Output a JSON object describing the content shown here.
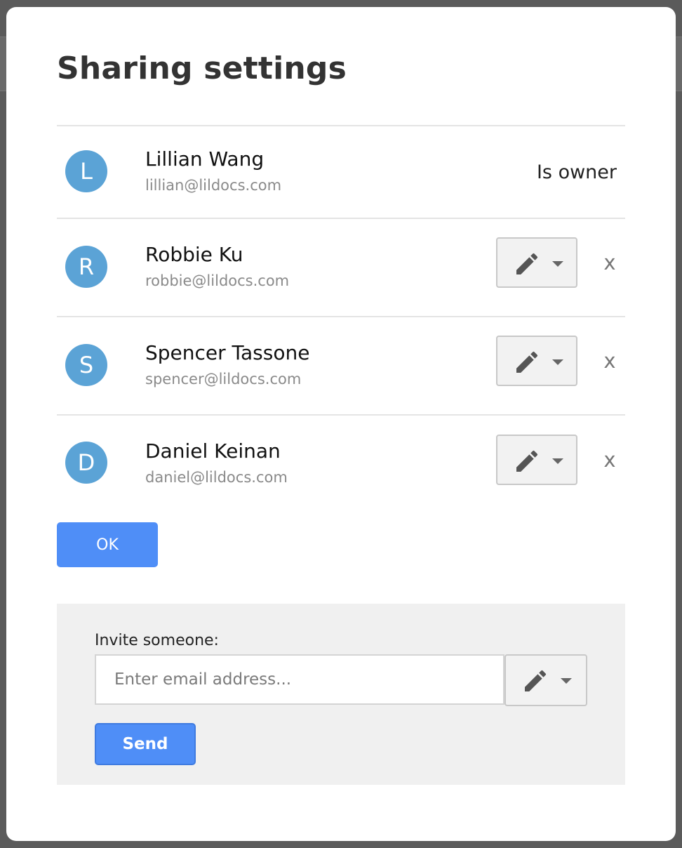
{
  "dialog": {
    "title": "Sharing settings"
  },
  "users": [
    {
      "initial": "L",
      "name": "Lillian Wang",
      "email": "lillian@lildocs.com",
      "role_label": "Is owner"
    },
    {
      "initial": "R",
      "name": "Robbie Ku",
      "email": "robbie@lildocs.com",
      "permission_icon": "pencil-icon",
      "remove_label": "x"
    },
    {
      "initial": "S",
      "name": "Spencer Tassone",
      "email": "spencer@lildocs.com",
      "permission_icon": "pencil-icon",
      "remove_label": "x"
    },
    {
      "initial": "D",
      "name": "Daniel Keinan",
      "email": "daniel@lildocs.com",
      "permission_icon": "pencil-icon",
      "remove_label": "x"
    }
  ],
  "ok_button": {
    "label": "OK"
  },
  "invite": {
    "label": "Invite someone:",
    "email_placeholder": "Enter email address...",
    "email_value": "",
    "permission_icon": "pencil-icon",
    "send_label": "Send"
  },
  "colors": {
    "avatar": "#5ba3d6",
    "primary_button": "#4f8ef7",
    "invite_panel": "#f0f0f0"
  }
}
